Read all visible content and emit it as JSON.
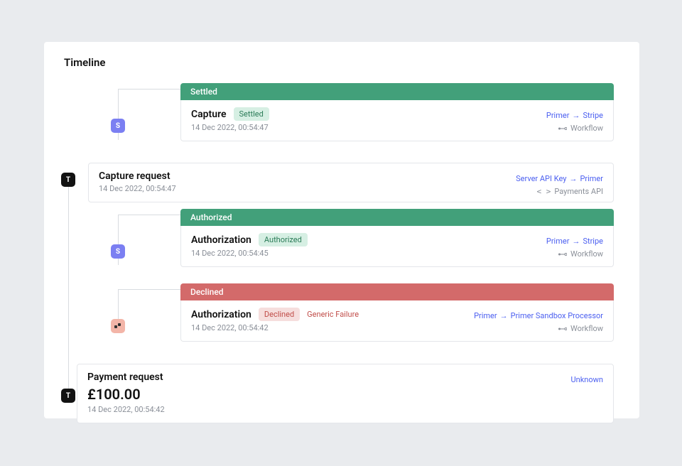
{
  "title": "Timeline",
  "icons": {
    "s": "S",
    "t": "T"
  },
  "workflow_label": "Workflow",
  "payments_api_label": "Payments API",
  "items": {
    "settled_banner": "Settled",
    "capture": {
      "title": "Capture",
      "pill": "Settled",
      "ts": "14 Dec 2022, 00:54:47",
      "from": "Primer",
      "to": "Stripe"
    },
    "capture_request": {
      "title": "Capture request",
      "ts": "14 Dec 2022, 00:54:47",
      "from": "Server API Key",
      "to": "Primer"
    },
    "authorized_banner": "Authorized",
    "auth1": {
      "title": "Authorization",
      "pill": "Authorized",
      "ts": "14 Dec 2022, 00:54:45",
      "from": "Primer",
      "to": "Stripe"
    },
    "declined_banner": "Declined",
    "auth2": {
      "title": "Authorization",
      "pill": "Declined",
      "fail": "Generic Failure",
      "ts": "14 Dec 2022, 00:54:42",
      "from": "Primer",
      "to": "Primer Sandbox Processor"
    },
    "payment_request": {
      "title": "Payment request",
      "amount": "£100.00",
      "ts": "14 Dec 2022, 00:54:42",
      "right": "Unknown"
    }
  }
}
